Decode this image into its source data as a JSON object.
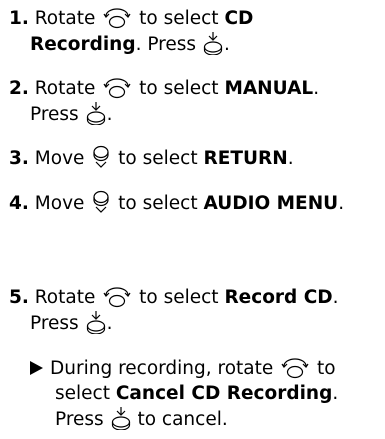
{
  "steps": [
    {
      "num": "1.",
      "t1": " Rotate ",
      "icon1": "rotate-knob-icon",
      "t2": " to select ",
      "b1": "CD",
      "line2_b": "Recording",
      "line2_t": ". Press ",
      "icon2": "press-knob-icon",
      "line2_end": "."
    },
    {
      "num": "2.",
      "t1": " Rotate ",
      "icon1": "rotate-knob-icon",
      "t2": " to select ",
      "b1": "MANUAL",
      "t3": ".",
      "line2_t": "Press ",
      "icon2": "press-knob-icon",
      "line2_end": "."
    },
    {
      "num": "3.",
      "t1": " Move ",
      "icon1": "move-knob-icon",
      "t2": " to select ",
      "b1": "RETURN",
      "t3": "."
    },
    {
      "num": "4.",
      "t1": " Move ",
      "icon1": "move-knob-icon",
      "t2": " to select ",
      "b1": "AUDIO MENU",
      "t3": "."
    },
    {
      "num": "5.",
      "t1": " Rotate ",
      "icon1": "rotate-knob-icon",
      "t2": " to select ",
      "b1": "Record CD",
      "t3": ".",
      "line2_t": "Press ",
      "icon2": "press-knob-icon",
      "line2_end": "."
    }
  ],
  "note": {
    "t1": "During recording, rotate ",
    "icon1": "rotate-knob-icon",
    "t2": " to",
    "t3": "select ",
    "b1": "Cancel CD Recording",
    "t4": ".",
    "t5": "Press ",
    "icon2": "press-knob-icon",
    "t6": " to cancel."
  }
}
